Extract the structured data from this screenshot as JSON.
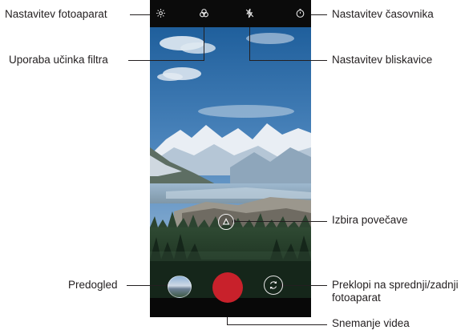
{
  "callouts": {
    "camera_settings": "Nastavitev fotoaparat",
    "filter_effect": "Uporaba učinka filtra",
    "timer_settings": "Nastavitev časovnika",
    "flash_settings": "Nastavitev bliskavice",
    "zoom_selection": "Izbira povečave",
    "preview": "Predogled",
    "switch_camera_line1": "Preklopi na sprednji/zadnji",
    "switch_camera_line2": "fotoaparat",
    "record_video": "Snemanje videa"
  },
  "icons": {
    "settings": "gear-icon",
    "filter": "filter-icon",
    "flash": "flash-off-icon",
    "timer": "timer-icon",
    "zoom": "zoom-icon",
    "switch": "camera-switch-icon"
  },
  "colors": {
    "shutter": "#c8212b",
    "text": "#231f20"
  }
}
